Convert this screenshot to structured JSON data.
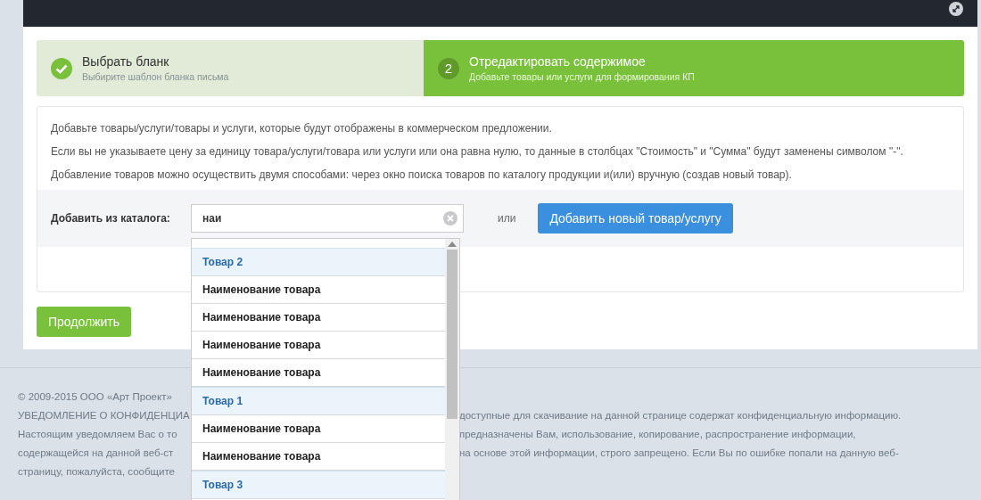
{
  "steps": [
    {
      "title": "Выбрать бланк",
      "subtitle": "Выбирите шаблон бланка письма",
      "completed": true,
      "selected": false
    },
    {
      "number": "2",
      "title": "Отредактировать содержимое",
      "subtitle": "Добавьте товары или услуги для формирования КП",
      "completed": false,
      "selected": true
    }
  ],
  "info": [
    "Добавьте товары/услуги/товары и услуги, которые будут отображены в коммерческом предложении.",
    "Если вы не указываете цену за единицу товара/услуги/товара или услуги или она равна нулю, то данные в столбцах \"Стоимость\" и \"Сумма\" будут заменены символом \"-\".",
    "Добавление товаров можно осуществить двумя способами: через окно поиска товаров по каталогу продукции и(или) вручную (создав новый товар)."
  ],
  "catalog": {
    "label": "Добавить из каталога:",
    "search": {
      "value": "наи"
    },
    "or_text": "или",
    "add_button": "Добавить новый товар/услугу"
  },
  "dropdown": [
    {
      "kind": "group",
      "label": "Товар 2"
    },
    {
      "kind": "item",
      "label": "Наименование товара"
    },
    {
      "kind": "item",
      "label": "Наименование товара"
    },
    {
      "kind": "item",
      "label": "Наименование товара"
    },
    {
      "kind": "item",
      "label": "Наименование товара"
    },
    {
      "kind": "group",
      "label": "Товар 1"
    },
    {
      "kind": "item",
      "label": "Наименование товара"
    },
    {
      "kind": "item",
      "label": "Наименование товара"
    },
    {
      "kind": "group",
      "label": "Товар 3"
    }
  ],
  "continue_button": "Продолжить",
  "footer": {
    "copyright": "© 2009-2015 ООО «Арт Проект»",
    "lines": [
      {
        "left": "УВЕДОМЛЕНИЕ О КОНФИДЕНЦИА",
        "right": "доступные для скачивание на данной странице содержат конфиденциальную информацию."
      },
      {
        "left": "Настоящим уведомляем Вас о то",
        "right": "предназначены Вам, использование, копирование, распространение информации,"
      },
      {
        "left": "содержащейся на данной веб-ст",
        "right": "на основе этой информации, строго запрещено. Если Вы по ошибке попали на данную веб-"
      },
      {
        "left": "страницу, пожалуйста, сообщите"
      }
    ]
  }
}
